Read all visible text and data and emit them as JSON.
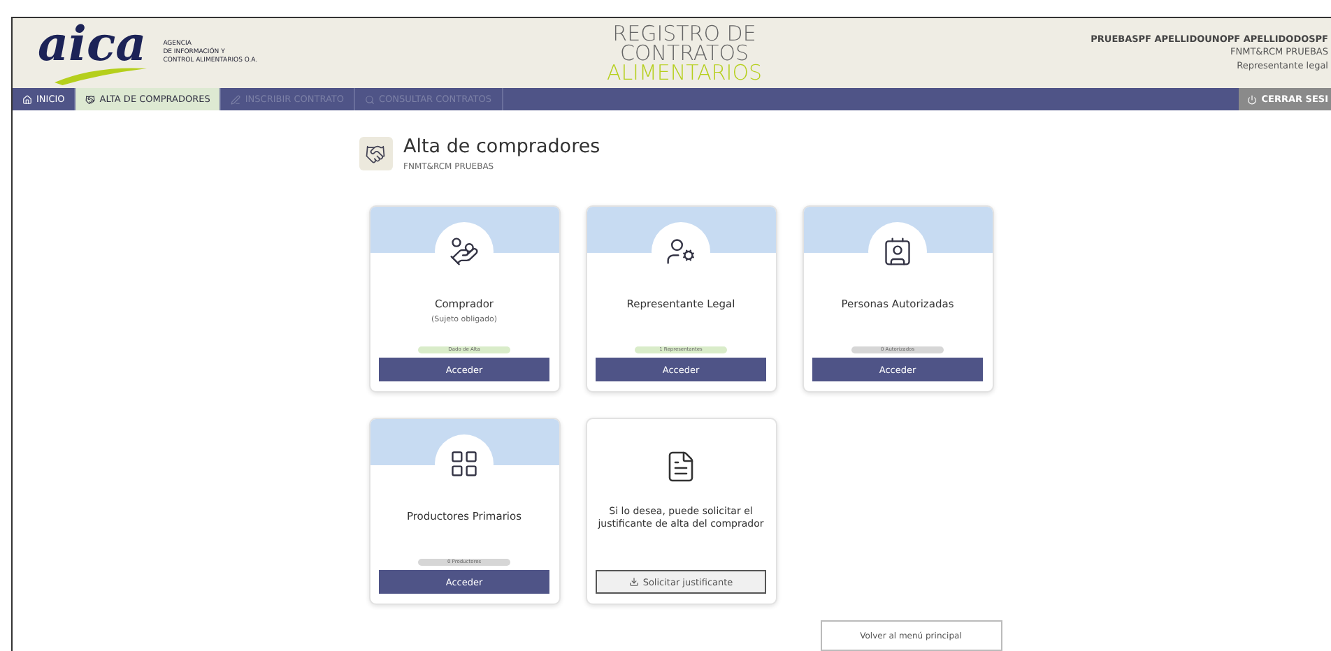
{
  "header": {
    "logo": "aica",
    "agency_lines": [
      "AGENCIA",
      "DE INFORMACIÓN Y",
      "CONTROL ALIMENTARIOS O.A."
    ],
    "title_lines": [
      "REGISTRO DE",
      "CONTRATOS",
      "ALIMENTARIOS"
    ],
    "user": {
      "name": "PRUEBASPF APELLIDOUNOPF APELLIDODOSPF",
      "entity": "FNMT&RCM PRUEBAS",
      "role": "Representante legal"
    }
  },
  "nav": {
    "tabs": [
      {
        "label": "INICIO",
        "selected": false,
        "disabled": false
      },
      {
        "label": "ALTA DE COMPRADORES",
        "selected": true,
        "disabled": false
      },
      {
        "label": "INSCRIBIR CONTRATO",
        "selected": false,
        "disabled": true
      },
      {
        "label": "CONSULTAR CONTRATOS",
        "selected": false,
        "disabled": true
      }
    ],
    "logout": "CERRAR SESI"
  },
  "page": {
    "title": "Alta de compradores",
    "subtitle": "FNMT&RCM PRUEBAS"
  },
  "cards": [
    {
      "kind": "section",
      "title": "Comprador",
      "subtitle": "(Sujeto obligado)",
      "badge": "Dado de Alta",
      "badge_active": true,
      "button": "Acceder"
    },
    {
      "kind": "section",
      "title": "Representante Legal",
      "badge": "1 Representantes",
      "badge_active": true,
      "button": "Acceder"
    },
    {
      "kind": "section",
      "title": "Personas Autorizadas",
      "badge": "0 Autorizados",
      "badge_active": false,
      "button": "Acceder"
    },
    {
      "kind": "section",
      "title": "Productores Primarios",
      "badge": "0 Productores",
      "badge_active": false,
      "button": "Acceder"
    },
    {
      "kind": "action",
      "text": "Si lo desea, puede solicitar el justificante de alta del comprador",
      "button": "Solicitar justificante"
    }
  ],
  "back_button": "Volver al menú principal"
}
